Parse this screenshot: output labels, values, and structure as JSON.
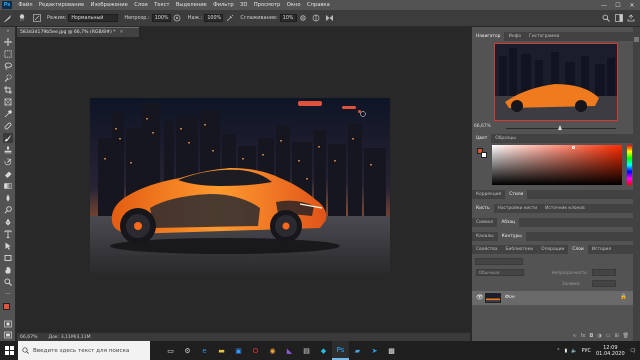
{
  "app": {
    "logo": "Ps",
    "window_controls": [
      "—",
      "☐",
      "✕"
    ]
  },
  "menu": [
    "Файл",
    "Редактирование",
    "Изображение",
    "Слои",
    "Текст",
    "Выделение",
    "Фильтр",
    "3D",
    "Просмотр",
    "Окно",
    "Справка"
  ],
  "options": {
    "brush_size": "17",
    "mode_label": "Режим:",
    "mode_value": "Нормальный",
    "opacity_label": "Непрозр.:",
    "opacity_value": "100%",
    "flow_label": "Наж.:",
    "flow_value": "100%",
    "smoothing_label": "Сглаживание:",
    "smoothing_value": "10%"
  },
  "document": {
    "tab_title": "583d34179b5ee.jpg @ 66,7% (RGB/8#) *",
    "zoom": "66,67%",
    "doc_info": "Док: 3,11M/3,11M"
  },
  "navigator": {
    "tabs": [
      "Навигатор",
      "Инфо",
      "Гистограмма"
    ],
    "zoom": "66,67%"
  },
  "color_panel": {
    "tabs": [
      "Цвет",
      "Образцы"
    ]
  },
  "adjust_panel": {
    "tabs": [
      "Коррекция",
      "Стили"
    ]
  },
  "brush_panel": {
    "tabs": [
      "Кисть",
      "Настройки кисти",
      "Источник клонов"
    ]
  },
  "symbols_panel": {
    "tabs": [
      "Символ",
      "Абзац"
    ]
  },
  "channels_panel": {
    "tabs": [
      "Каналы",
      "Контуры"
    ]
  },
  "layers_group": {
    "tabs": [
      "Свойства",
      "Библиотеки",
      "Операции",
      "Слои",
      "История"
    ]
  },
  "layers": {
    "mode": "Обычные",
    "opacity_label": "Непрозрачность:",
    "fill_label": "Заливка:",
    "items": [
      {
        "name": "Фон"
      }
    ]
  },
  "taskbar": {
    "search_placeholder": "Введите здесь текст для поиска",
    "lang": "РУС",
    "time": "12:09",
    "date": "01.04.2020"
  },
  "colors": {
    "foreground": "#e0533a",
    "background": "#ffffff",
    "car_orange": "#f07a1e",
    "hue_accent": "#cc3b22"
  }
}
